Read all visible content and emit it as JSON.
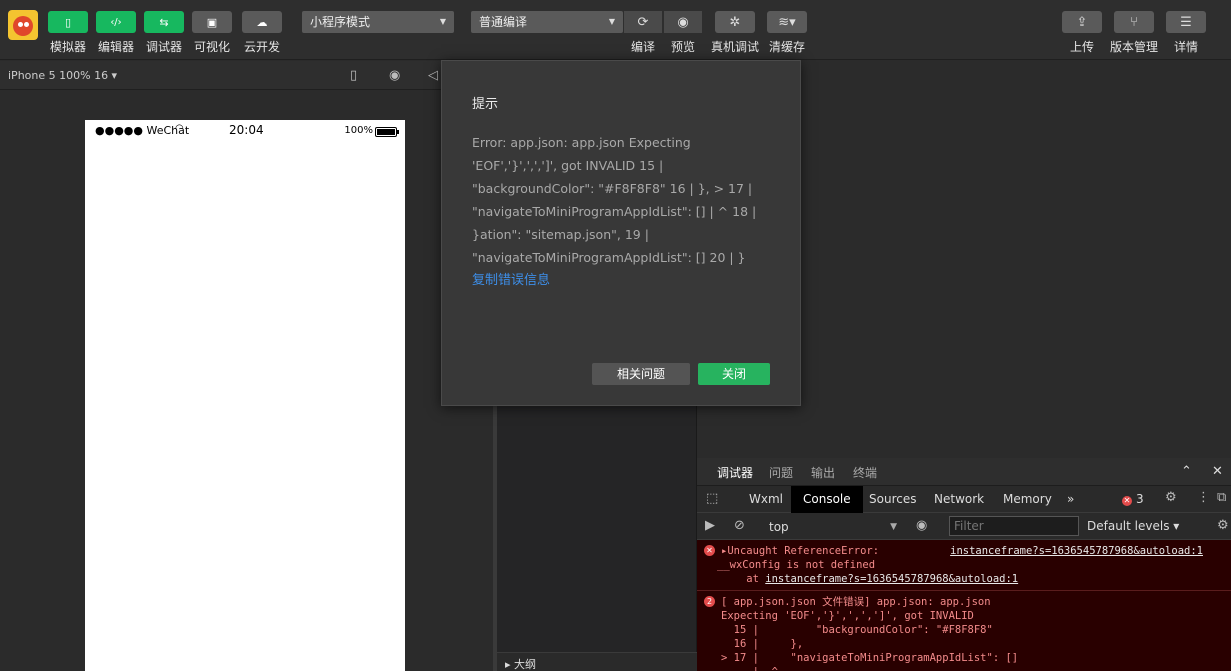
{
  "toolbar": {
    "left_buttons": [
      {
        "label": "模拟器",
        "icon": "phone-icon"
      },
      {
        "label": "编辑器",
        "icon": "code-icon"
      },
      {
        "label": "调试器",
        "icon": "debug-icon"
      },
      {
        "label": "可视化",
        "icon": "layout-icon"
      },
      {
        "label": "云开发",
        "icon": "cloud-icon"
      }
    ],
    "mode_select": "小程序模式",
    "compile_select": "普通编译",
    "compile_label": "编译",
    "preview_label": "预览",
    "real_debug_label": "真机调试",
    "clear_cache_label": "清缓存",
    "upload_label": "上传",
    "version_label": "版本管理",
    "details_label": "详情"
  },
  "simulator": {
    "device_info": "iPhone 5 100% 16 ▾",
    "status_left": "●●●●● WeChat",
    "status_time": "20:04",
    "status_battery": "100%"
  },
  "dialog": {
    "title": "提示",
    "message": "Error: app.json: app.json Expecting 'EOF','}',',',']', got INVALID 15 | \"backgroundColor\": \"#F8F8F8\" 16 | }, > 17 | \"navigateToMiniProgramAppIdList\": [] | ^ 18 | }ation\": \"sitemap.json\", 19 | \"navigateToMiniProgramAppIdList\": [] 20 | }",
    "copy_link": "复制错误信息",
    "related_button": "相关问题",
    "close_button": "关闭"
  },
  "outline_label": "▸ 大纲",
  "debugger": {
    "tabs": [
      "调试器",
      "问题",
      "输出",
      "终端"
    ],
    "devtools_tabs": [
      "Wxml",
      "Console",
      "Sources",
      "Network",
      "Memory"
    ],
    "more": "»",
    "error_count": "3",
    "context": "top",
    "filter_placeholder": "Filter",
    "levels": "Default levels ▾",
    "logs": [
      {
        "icon": "✕",
        "text_prefix": "▸Uncaught ReferenceError:",
        "text_line2": "__wxConfig is not defined",
        "at_prefix": "    at ",
        "at_link": "instanceframe?s=1636545787968&autoload:1",
        "source": "instanceframe?s=1636545787968&autoload:1"
      },
      {
        "icon": "2",
        "text": "[ app.json.json 文件错误] app.json: app.json\nExpecting 'EOF','}',',',']', got INVALID\n  15 |         \"backgroundColor\": \"#F8F8F8\"\n  16 |     },\n> 17 |     \"navigateToMiniProgramAppIdList\": []\n     |  ^"
      }
    ]
  }
}
